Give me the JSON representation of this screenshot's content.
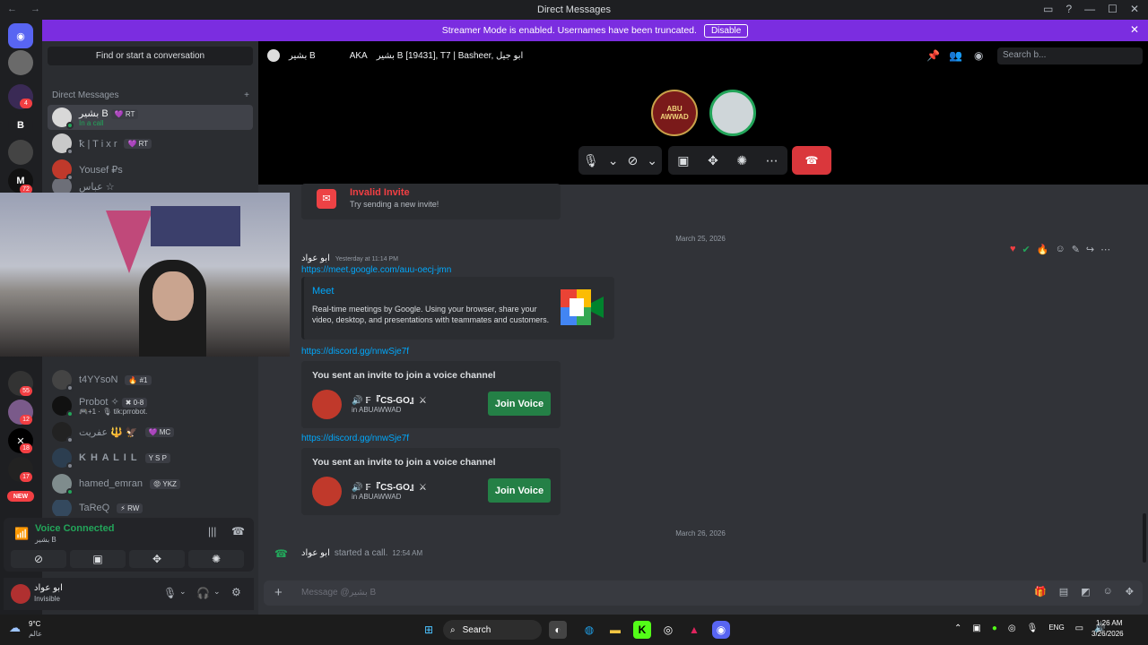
{
  "window": {
    "title": "Direct Messages",
    "nav": "← →",
    "controls": [
      "▭",
      "?",
      "—",
      "☐",
      "✕"
    ]
  },
  "banner": {
    "text": "Streamer Mode is enabled. Usernames have been truncated.",
    "button": "Disable",
    "close": "✕"
  },
  "servers": {
    "letters": [
      "B",
      "M"
    ],
    "badges": [
      "4",
      "72",
      "55",
      "12",
      "18",
      "17"
    ],
    "new_label": "NEW"
  },
  "sidebar": {
    "find": "Find or start a conversation",
    "dm_header": "Direct Messages",
    "add": "+",
    "dms": [
      {
        "name": "بشير B",
        "tag": "💜 RT",
        "sub": "In a call"
      },
      {
        "name": "ꝁ | T i x r",
        "tag": "💜 RT"
      },
      {
        "name": "Yousef ₽s"
      },
      {
        "name": "عباس ☆"
      },
      {
        "name": "t4YYsoN",
        "tag": "🔥 #1"
      },
      {
        "name": "Probot ✧",
        "tag": "✖ 0-8",
        "sub": "🎮+1 · 🎙 tik:prrobot."
      },
      {
        "name": "عفريت 🔱 🦅",
        "tag": "💜 MC"
      },
      {
        "name": "K H A L I L",
        "tag": "Y S P"
      },
      {
        "name": "hamed_emran",
        "tag": "😡 YKZ"
      },
      {
        "name": "TaReQ",
        "tag": "⚡ RW"
      }
    ]
  },
  "voice": {
    "status": "Voice Connected",
    "channel": "بشير B"
  },
  "user": {
    "name": "ابو عواد",
    "status": "Invisible"
  },
  "header": {
    "name": "بشير B",
    "aka_label": "AKA",
    "aka": "بشير B [19431], T7 | Basheer, ابو جيل",
    "search_placeholder": "Search b..."
  },
  "messages": {
    "invalid_title": "Invalid Invite",
    "invalid_sub": "Try sending a new invite!",
    "date1": "March 25, 2026",
    "author": "ابو عواد",
    "time": "Yesterday at 11:14 PM",
    "meet_link": "https://meet.google.com/auu-oecj-jmn",
    "meet_title": "Meet",
    "meet_desc": "Real-time meetings by Google. Using your browser, share your video, desktop, and presentations with teammates and customers.",
    "invites": [
      {
        "link": "https://discord.gg/nnwSje7f",
        "title": "You sent an invite to join a voice channel",
        "channel": "🔊 𝔽『CS-GO』⚔",
        "server": "in ABUAWWAD",
        "button": "Join Voice"
      },
      {
        "link": "https://discord.gg/nnwSje7f",
        "title": "You sent an invite to join a voice channel",
        "channel": "🔊 𝔽『CS-GO』⚔",
        "server": "in ABUAWWAD",
        "button": "Join Voice"
      }
    ],
    "date2": "March 26, 2026",
    "call_author": "ابو عواد",
    "call_text": "started a call.",
    "call_time": "12:54 AM",
    "composer_placeholder": "Message @بشير B"
  },
  "call_avatar_text": "ABU AWWAD",
  "taskbar": {
    "weather_temp": "9°C",
    "weather_loc": "عالم",
    "search": "Search",
    "lang": "ENG",
    "time": "1:26 AM",
    "date": "3/26/2026"
  },
  "colors": {
    "accent": "#5865f2",
    "banner": "#7b2de0",
    "green": "#248046",
    "red": "#da373c"
  }
}
